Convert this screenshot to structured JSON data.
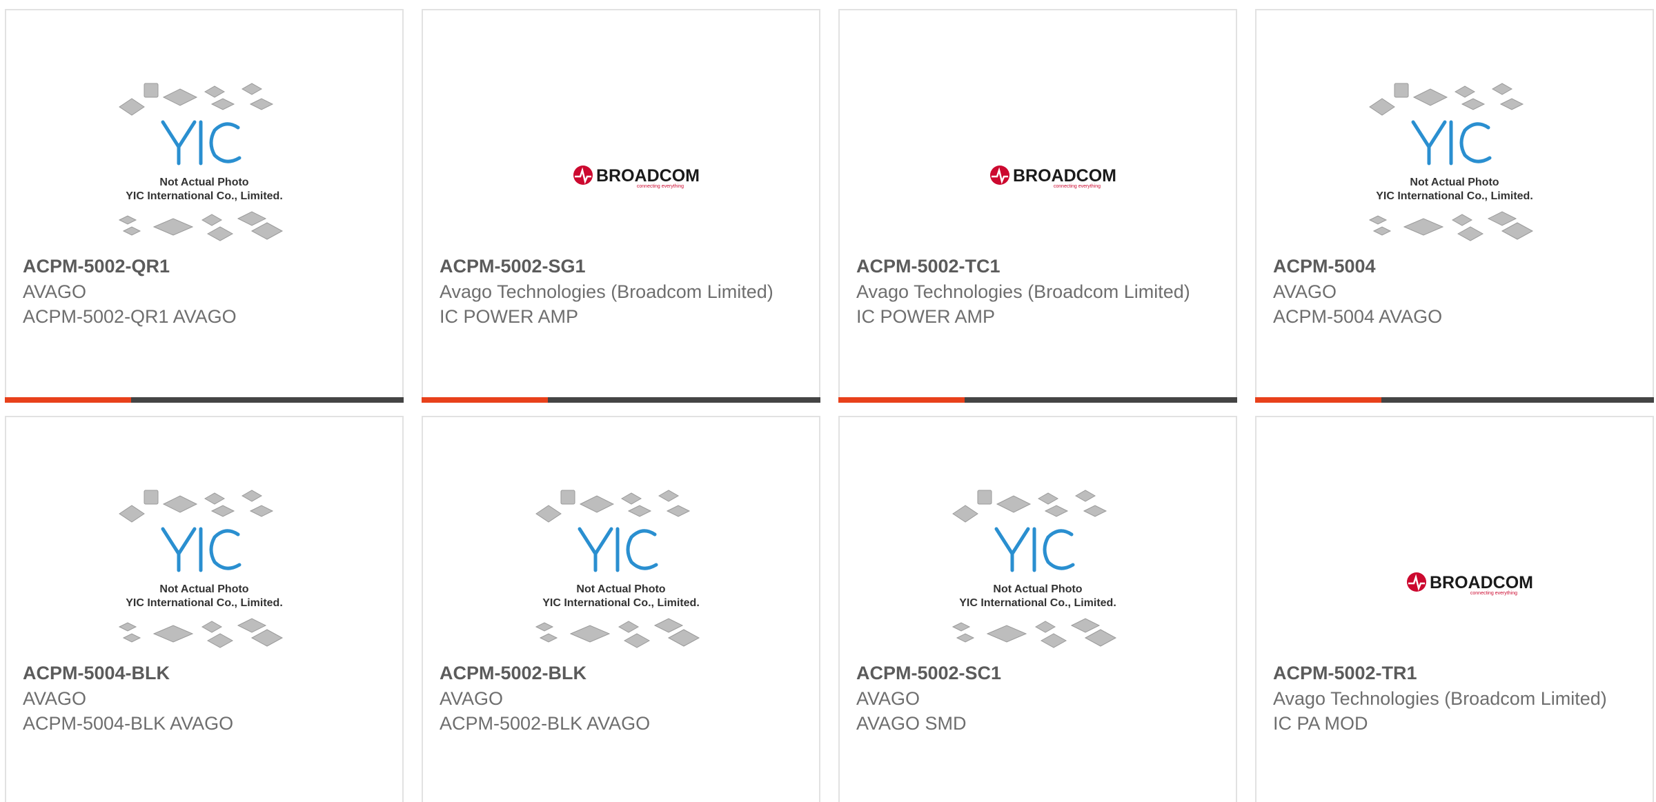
{
  "cards": [
    {
      "part": "ACPM-5002-QR1",
      "maker": "AVAGO",
      "desc": "ACPM-5002-QR1 AVAGO",
      "image": "yic-placeholder"
    },
    {
      "part": "ACPM-5002-SG1",
      "maker": "Avago Technologies (Broadcom Limited)",
      "desc": "IC POWER AMP",
      "image": "broadcom-logo"
    },
    {
      "part": "ACPM-5002-TC1",
      "maker": "Avago Technologies (Broadcom Limited)",
      "desc": "IC POWER AMP",
      "image": "broadcom-logo"
    },
    {
      "part": "ACPM-5004",
      "maker": "AVAGO",
      "desc": "ACPM-5004 AVAGO",
      "image": "yic-placeholder"
    },
    {
      "part": "ACPM-5004-BLK",
      "maker": "AVAGO",
      "desc": "ACPM-5004-BLK AVAGO",
      "image": "yic-placeholder"
    },
    {
      "part": "ACPM-5002-BLK",
      "maker": "AVAGO",
      "desc": "ACPM-5002-BLK AVAGO",
      "image": "yic-placeholder"
    },
    {
      "part": "ACPM-5002-SC1",
      "maker": "AVAGO",
      "desc": "AVAGO SMD",
      "image": "yic-placeholder"
    },
    {
      "part": "ACPM-5002-TR1",
      "maker": "Avago Technologies (Broadcom Limited)",
      "desc": "IC PA MOD",
      "image": "broadcom-logo"
    }
  ],
  "yic_placeholder": {
    "brand": "YIC",
    "caption_line1": "Not Actual Photo",
    "caption_line2": "YIC International Co., Limited."
  },
  "broadcom_logo": {
    "wordmark": "BROADCOM",
    "tagline": "connecting everything"
  },
  "colors": {
    "accent": "#e8411b",
    "accent_dark": "#444444",
    "part_text": "#5b5b5b",
    "body_text": "#6e6e6e",
    "yic_blue": "#2a8fd0",
    "broadcom_red": "#cc092f"
  }
}
